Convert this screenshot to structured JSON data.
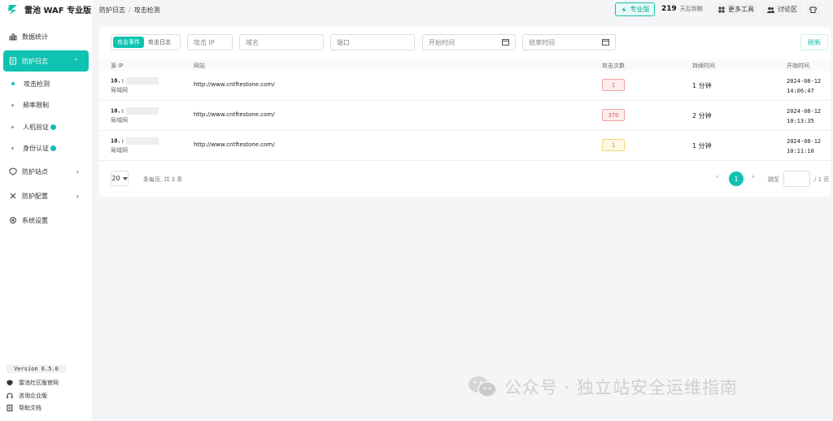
{
  "app": {
    "name": "雷池 WAF 专业版"
  },
  "sidebar": {
    "items": [
      {
        "label": "数据统计",
        "icon": "bar-chart-icon"
      },
      {
        "label": "防护日志",
        "icon": "log-icon",
        "chev": "⌃"
      },
      {
        "label": "防护站点",
        "icon": "shield-icon",
        "chev": "›"
      },
      {
        "label": "防护配置",
        "icon": "tools-icon",
        "chev": "›"
      },
      {
        "label": "系统设置",
        "icon": "gear-icon"
      }
    ],
    "sub": [
      {
        "label": "攻击检测"
      },
      {
        "label": "频率限制"
      },
      {
        "label": "人机验证"
      },
      {
        "label": "身份认证"
      }
    ],
    "version": "Version 6.5.0",
    "footer": [
      {
        "label": "雷池社区版官网"
      },
      {
        "label": "咨询企业版"
      },
      {
        "label": "帮助文档"
      }
    ]
  },
  "header": {
    "crumb_parent": "防护日志",
    "crumb_sep": "/",
    "crumb_current": "攻击检测",
    "pro_label": "专业版",
    "days_num": "219",
    "days_txt": "天后到期",
    "more_tools": "更多工具",
    "forum": "讨论区"
  },
  "filters": {
    "seg_on": "攻击事件",
    "seg_off": "攻击日志",
    "ip_placeholder": "攻击 IP",
    "domain_placeholder": "域名",
    "port_placeholder": "端口",
    "start_placeholder": "开始时间",
    "end_placeholder": "结束时间",
    "refresh": "刷新"
  },
  "table": {
    "headers": [
      "源 IP",
      "网站",
      "攻击次数",
      "持续时间",
      "开始时间"
    ],
    "rows": [
      {
        "ip": "10.:",
        "lan": "局域网",
        "site": "http://www.cntftestone.com/",
        "count": "1",
        "level": "red",
        "duration": "1 分钟",
        "date": "2024-08-12",
        "time": "14:06:47"
      },
      {
        "ip": "10.:",
        "lan": "局域网",
        "site": "http://www.cntftestone.com/",
        "count": "370",
        "level": "red",
        "duration": "2 分钟",
        "date": "2024-08-12",
        "time": "10:13:35"
      },
      {
        "ip": "10.:",
        "lan": "局域网",
        "site": "http://www.cntftestone.com/",
        "count": "1",
        "level": "yellow",
        "duration": "1 分钟",
        "date": "2024-08-12",
        "time": "10:11:10"
      }
    ]
  },
  "pagination": {
    "page_size": "20",
    "summary": "条每页, 共 3 条",
    "current": "1",
    "jump_label": "跳至",
    "total": "/ 1 页"
  },
  "watermark": "公众号 · 独立站安全运维指南",
  "colors": {
    "accent": "#10c2b1",
    "red": "#e35d5d",
    "yellow": "#d0a01a"
  }
}
